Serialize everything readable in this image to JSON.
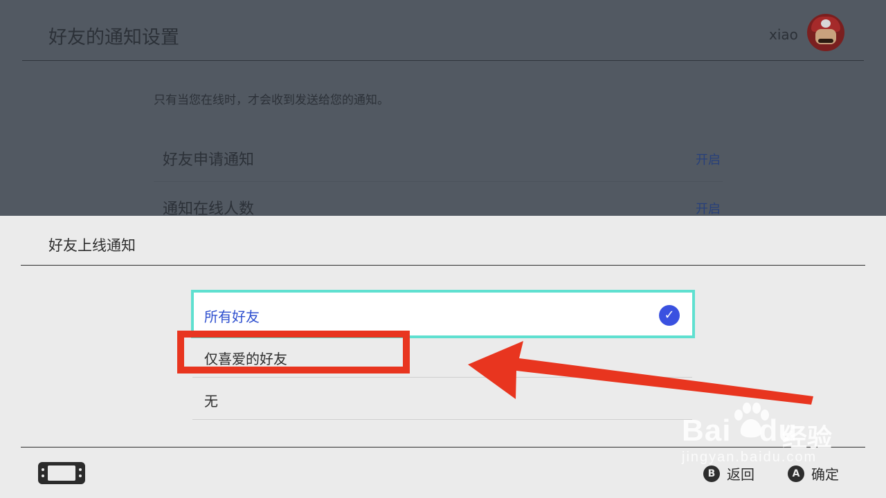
{
  "background": {
    "title": "好友的通知设置",
    "username": "xiao",
    "note": "只有当您在线时，才会收到发送给您的通知。",
    "rows": [
      {
        "label": "好友申请通知",
        "value": "开启"
      },
      {
        "label": "通知在线人数",
        "value": "开启"
      }
    ]
  },
  "sheet": {
    "title": "好友上线通知",
    "options": [
      {
        "label": "所有好友",
        "selected": true
      },
      {
        "label": "仅喜爱的好友",
        "selected": false
      },
      {
        "label": "无",
        "selected": false
      }
    ],
    "check_icon": "✓"
  },
  "footer": {
    "back_key": "B",
    "back_label": "返回",
    "confirm_key": "A",
    "confirm_label": "确定"
  },
  "watermark": {
    "brand": "Bai",
    "brand2": "du",
    "brand_cn": "经验",
    "url": "jingyan.baidu.com"
  },
  "colors": {
    "accent": "#2e4fcf",
    "highlight_border": "#5fe0d0",
    "annotation": "#e8351f"
  }
}
